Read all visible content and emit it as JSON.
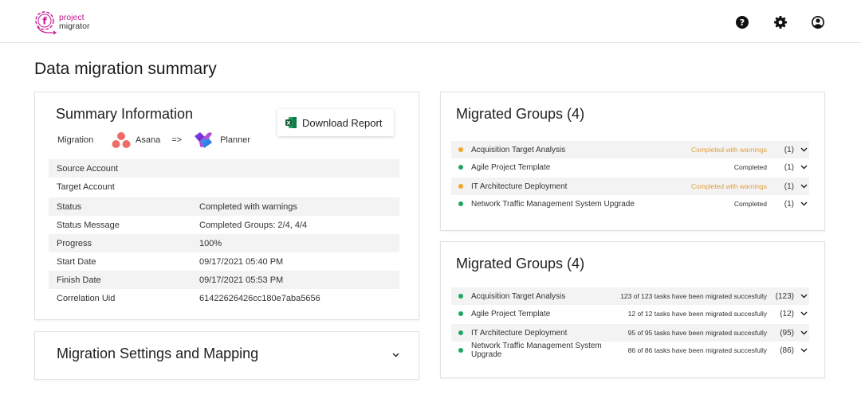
{
  "app": {
    "logo_line1": "project",
    "logo_line2": "migrator",
    "brand_color": "#c2188f"
  },
  "header_icons": [
    {
      "name": "help-icon"
    },
    {
      "name": "gear-icon"
    },
    {
      "name": "user-account-icon"
    }
  ],
  "page_title": "Data migration summary",
  "summary": {
    "title": "Summary Information",
    "migration_label": "Migration",
    "source_app": "Asana",
    "arrow": "=>",
    "target_app": "Planner",
    "download_label": "Download Report",
    "rows": [
      {
        "key": "Source Account",
        "value": ""
      },
      {
        "key": "Target Account",
        "value": ""
      },
      {
        "key": "Status",
        "value": "Completed with warnings"
      },
      {
        "key": "Status Message",
        "value": "Completed Groups: 2/4, 4/4"
      },
      {
        "key": "Progress",
        "value": "100%"
      },
      {
        "key": "Start Date",
        "value": "09/17/2021 05:40 PM"
      },
      {
        "key": "Finish Date",
        "value": "09/17/2021 05:53 PM"
      },
      {
        "key": "Correlation Uid",
        "value": "61422626426cc180e7aba5656"
      }
    ]
  },
  "settings": {
    "title": "Migration Settings and Mapping"
  },
  "colors": {
    "warning": "#f5a623",
    "warning_text": "#e0a040",
    "success": "#1fa463"
  },
  "groups_status": {
    "title": "Migrated Groups (4)",
    "items": [
      {
        "name": "Acquisition Target Analysis",
        "status": "Completed with warnings",
        "state": "warning",
        "count": "(1)"
      },
      {
        "name": "Agile Project Template",
        "status": "Completed",
        "state": "success",
        "count": "(1)"
      },
      {
        "name": "IT Architecture Deployment",
        "status": "Completed with warnings",
        "state": "warning",
        "count": "(1)"
      },
      {
        "name": "Network Traffic Management System Upgrade",
        "status": "Completed",
        "state": "success",
        "count": "(1)"
      }
    ]
  },
  "groups_tasks": {
    "title": "Migrated Groups (4)",
    "items": [
      {
        "name": "Acquisition Target Analysis",
        "status": "123 of 123 tasks have been migrated succesfully",
        "state": "success",
        "count": "(123)"
      },
      {
        "name": "Agile Project Template",
        "status": "12 of 12 tasks have been migrated succesfully",
        "state": "success",
        "count": "(12)"
      },
      {
        "name": "IT Architecture Deployment",
        "status": "95 of 95 tasks have been migrated succesfully",
        "state": "success",
        "count": "(95)"
      },
      {
        "name": "Network Traffic Management System Upgrade",
        "status": "86 of 86 tasks have been migrated succesfully",
        "state": "success",
        "count": "(86)"
      }
    ]
  }
}
